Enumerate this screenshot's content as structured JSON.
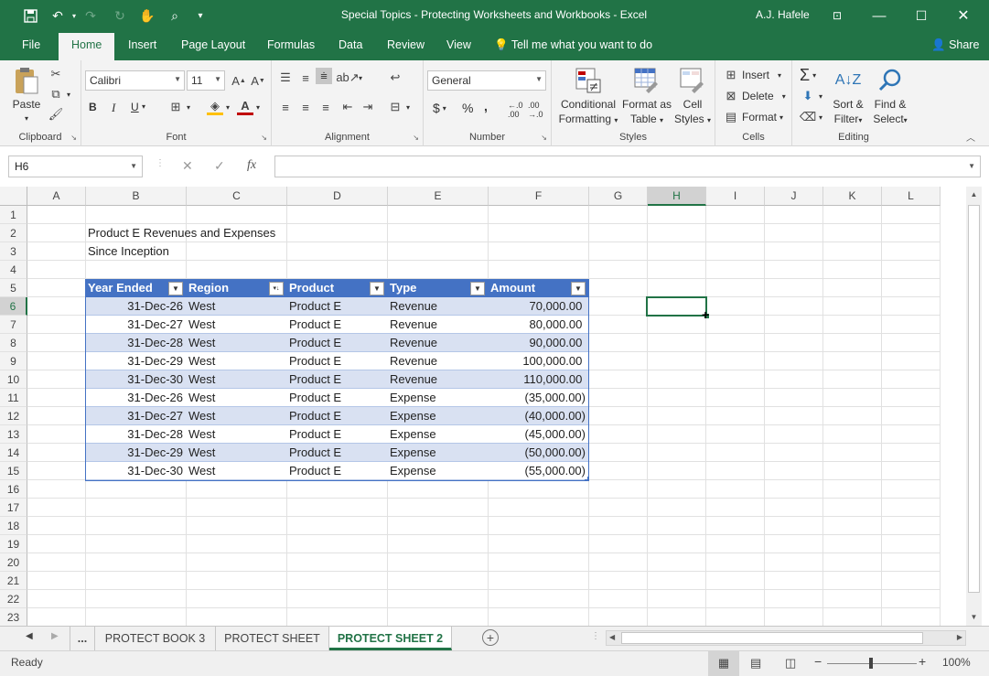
{
  "window": {
    "title": "Special Topics - Protecting Worksheets and Workbooks  -  Excel",
    "user": "A.J. Hafele"
  },
  "menu": {
    "tabs": [
      "File",
      "Home",
      "Insert",
      "Page Layout",
      "Formulas",
      "Data",
      "Review",
      "View"
    ],
    "tell_me": "Tell me what you want to do",
    "share": "Share"
  },
  "ribbon": {
    "clipboard": {
      "label": "Clipboard",
      "paste": "Paste"
    },
    "font": {
      "label": "Font",
      "name": "Calibri",
      "size": "11",
      "bold": "B",
      "italic": "I",
      "underline": "U"
    },
    "alignment": {
      "label": "Alignment"
    },
    "number": {
      "label": "Number",
      "format": "General",
      "currency": "$",
      "percent": "%",
      "comma": ","
    },
    "styles": {
      "label": "Styles",
      "conditional_1": "Conditional",
      "conditional_2": "Formatting",
      "format_table_1": "Format as",
      "format_table_2": "Table",
      "cell_styles_1": "Cell",
      "cell_styles_2": "Styles"
    },
    "cells": {
      "label": "Cells",
      "insert": "Insert",
      "delete": "Delete",
      "format": "Format"
    },
    "editing": {
      "label": "Editing",
      "sort_1": "Sort &",
      "sort_2": "Filter",
      "find_1": "Find &",
      "find_2": "Select"
    }
  },
  "formula_bar": {
    "name_box": "H6",
    "fx": "fx",
    "value": ""
  },
  "columns": [
    "A",
    "B",
    "C",
    "D",
    "E",
    "F",
    "G",
    "H",
    "I",
    "J",
    "K",
    "L"
  ],
  "rows": [
    "1",
    "2",
    "3",
    "4",
    "5",
    "6",
    "7",
    "8",
    "9",
    "10",
    "11",
    "12",
    "13",
    "14",
    "15",
    "16",
    "17",
    "18",
    "19",
    "20",
    "21",
    "22",
    "23"
  ],
  "sheet": {
    "heading1": "Product E Revenues and Expenses",
    "heading2": "Since Inception",
    "table": {
      "headers": [
        "Year Ended",
        "Region",
        "Product",
        "Type",
        "Amount"
      ],
      "rows": [
        [
          "31-Dec-26",
          "West",
          "Product E",
          "Revenue",
          "70,000.00 "
        ],
        [
          "31-Dec-27",
          "West",
          "Product E",
          "Revenue",
          "80,000.00 "
        ],
        [
          "31-Dec-28",
          "West",
          "Product E",
          "Revenue",
          "90,000.00 "
        ],
        [
          "31-Dec-29",
          "West",
          "Product E",
          "Revenue",
          "100,000.00 "
        ],
        [
          "31-Dec-30",
          "West",
          "Product E",
          "Revenue",
          "110,000.00 "
        ],
        [
          "31-Dec-26",
          "West",
          "Product E",
          "Expense",
          "(35,000.00)"
        ],
        [
          "31-Dec-27",
          "West",
          "Product E",
          "Expense",
          "(40,000.00)"
        ],
        [
          "31-Dec-28",
          "West",
          "Product E",
          "Expense",
          "(45,000.00)"
        ],
        [
          "31-Dec-29",
          "West",
          "Product E",
          "Expense",
          "(50,000.00)"
        ],
        [
          "31-Dec-30",
          "West",
          "Product E",
          "Expense",
          "(55,000.00)"
        ]
      ]
    }
  },
  "sheet_tabs": {
    "ellipsis": "...",
    "tabs": [
      "PROTECT BOOK 3",
      "PROTECT SHEET",
      "PROTECT SHEET 2"
    ],
    "active": "PROTECT SHEET 2"
  },
  "status": {
    "ready": "Ready",
    "zoom": "100%"
  },
  "colors": {
    "accent": "#217346",
    "table_header": "#4472c4",
    "band": "#d9e1f2"
  }
}
